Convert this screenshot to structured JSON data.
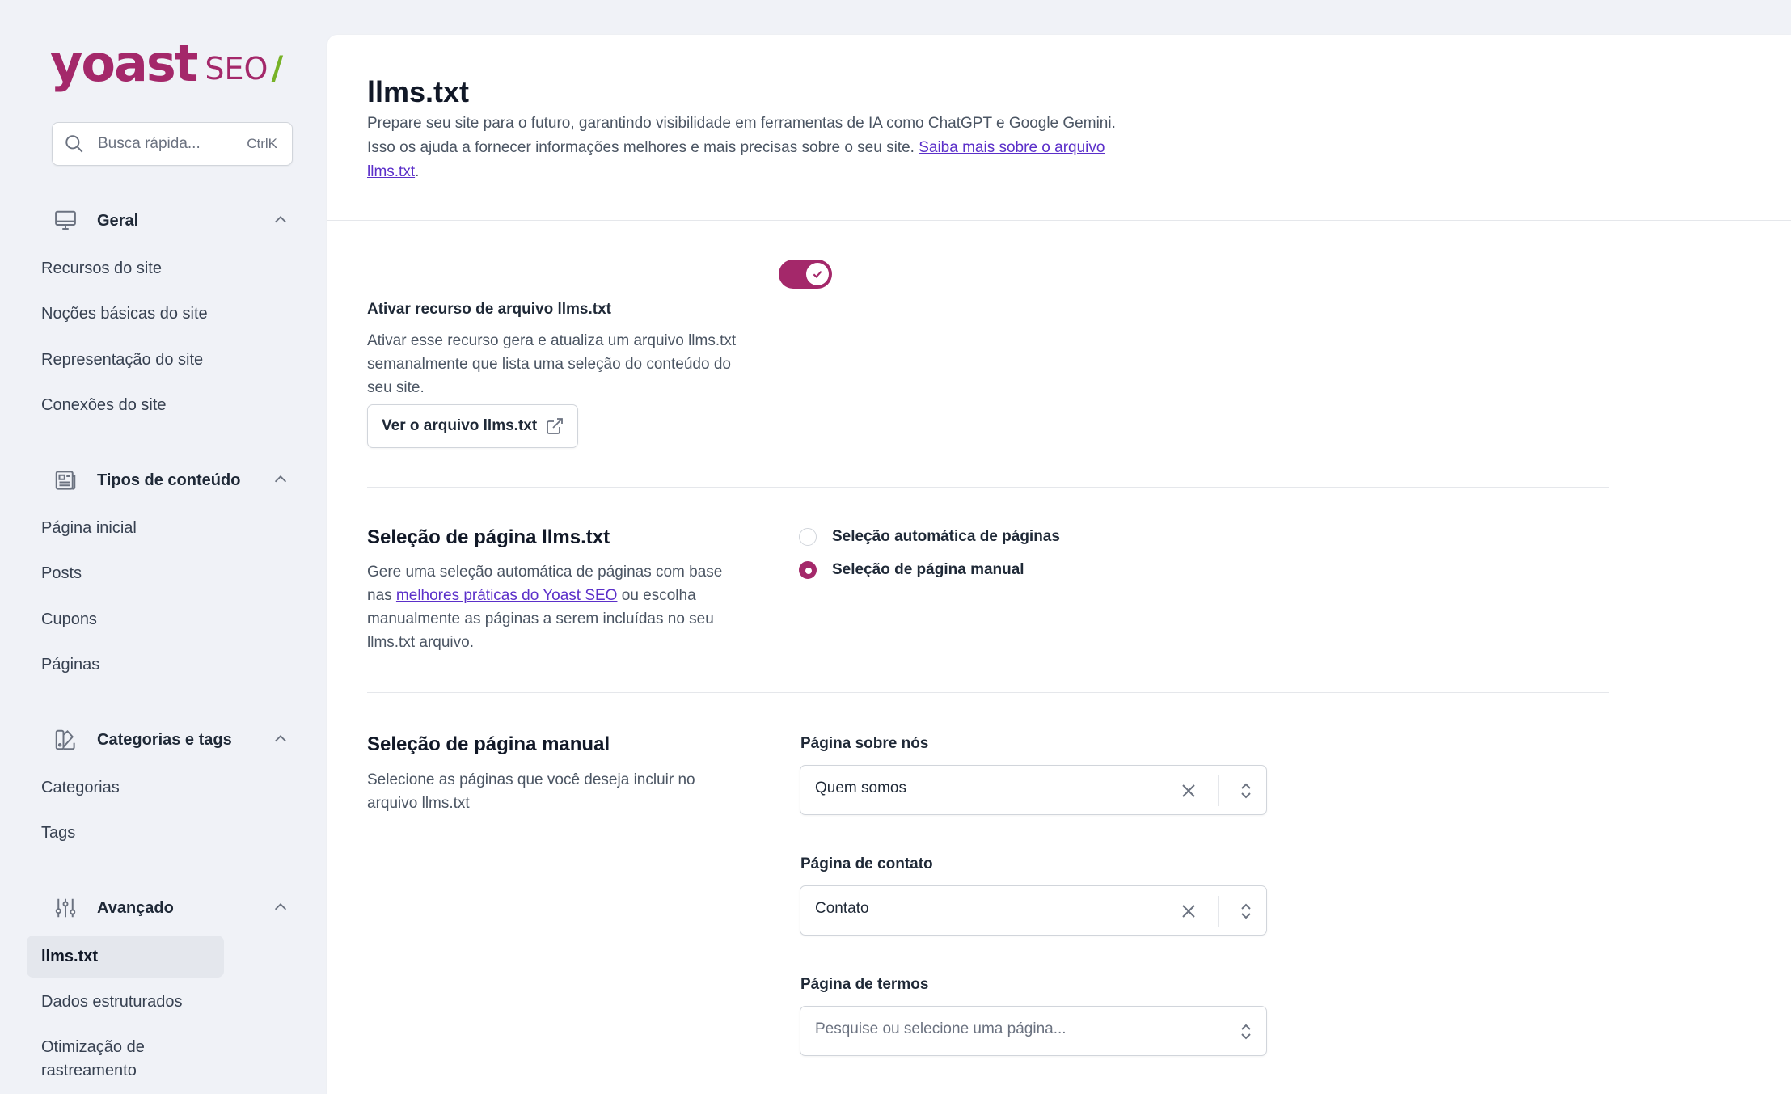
{
  "brand": {
    "word": "yoast",
    "product": "SEO",
    "slash": "/"
  },
  "search": {
    "placeholder": "Busca rápida...",
    "shortcut": "CtrlK"
  },
  "sidebar": {
    "groups": [
      {
        "label": "Geral",
        "icon": "desktop-icon",
        "items": [
          "Recursos do site",
          "Noções básicas do site",
          "Representação do site",
          "Conexões do site"
        ]
      },
      {
        "label": "Tipos de conteúdo",
        "icon": "newspaper-icon",
        "items": [
          "Página inicial",
          "Posts",
          "Cupons",
          "Páginas"
        ]
      },
      {
        "label": "Categorias e tags",
        "icon": "tag-swatch-icon",
        "items": [
          "Categorias",
          "Tags"
        ]
      },
      {
        "label": "Avançado",
        "icon": "sliders-icon",
        "items": [
          "llms.txt",
          "Dados estruturados",
          "Otimização de rastreamento"
        ]
      }
    ],
    "active_item": "llms.txt"
  },
  "page": {
    "title": "llms.txt",
    "desc_line1": "Prepare seu site para o futuro, garantindo visibilidade em ferramentas de IA como ChatGPT e Google Gemini.",
    "desc_line2": "Isso os ajuda a fornecer informações melhores e mais precisas sobre o seu site.",
    "desc_link": "Saiba mais sobre o arquivo llms.txt",
    "desc_end": "."
  },
  "feature": {
    "label": "Ativar recurso de arquivo llms.txt",
    "description": "Ativar esse recurso gera e atualiza um arquivo llms.txt semanalmente que lista uma seleção do conteúdo do seu site.",
    "enabled": true,
    "view_button": "Ver o arquivo llms.txt"
  },
  "selection": {
    "title": "Seleção de página llms.txt",
    "desc_before": "Gere uma seleção automática de páginas com base nas",
    "desc_link": "melhores práticas do Yoast SEO",
    "desc_after": "ou escolha manualmente as páginas a serem incluídas no seu llms.txt arquivo.",
    "options": [
      {
        "label": "Seleção automática de páginas",
        "checked": false
      },
      {
        "label": "Seleção de página manual",
        "checked": true
      }
    ]
  },
  "manual": {
    "title": "Seleção de página manual",
    "description": "Selecione as páginas que você deseja incluir no arquivo llms.txt",
    "fields": [
      {
        "label": "Página sobre nós",
        "value": "Quem somos"
      },
      {
        "label": "Página de contato",
        "value": "Contato"
      },
      {
        "label": "Página de termos",
        "placeholder": "Pesquise ou selecione uma página..."
      }
    ]
  },
  "colors": {
    "brand": "#a4286a",
    "accent_green": "#77b227",
    "link": "#5b2fc9",
    "background": "#f0f2f7"
  }
}
